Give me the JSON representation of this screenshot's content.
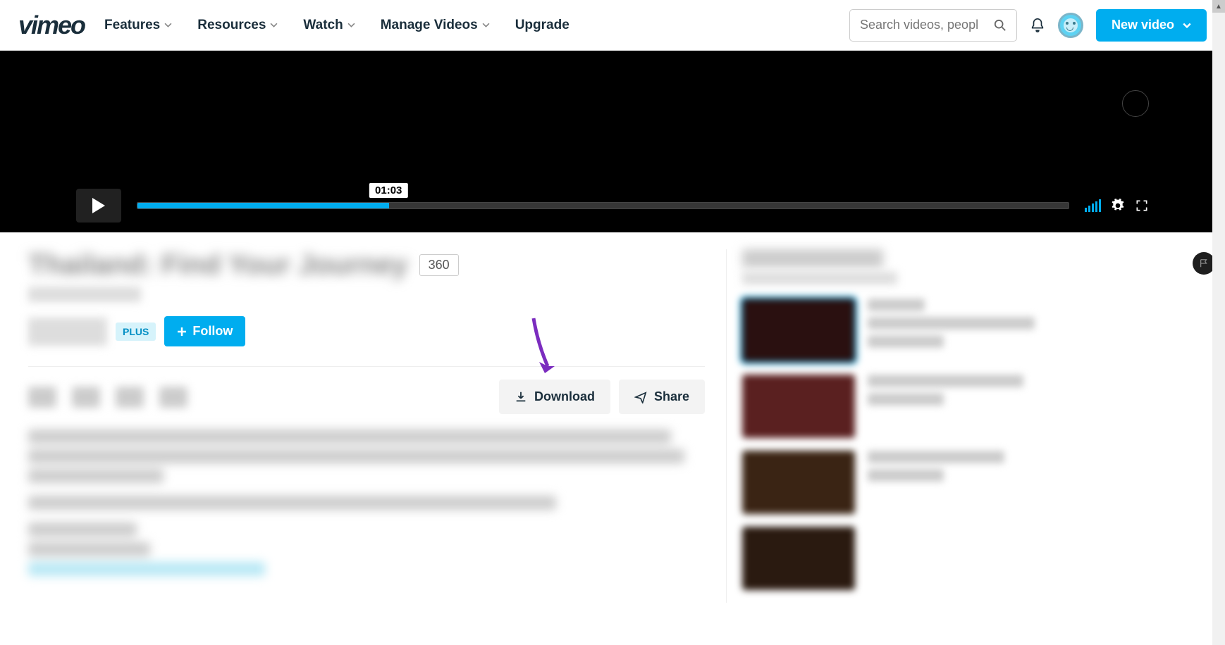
{
  "header": {
    "logo": "vimeo",
    "nav": {
      "features": "Features",
      "resources": "Resources",
      "watch": "Watch",
      "manage": "Manage Videos",
      "upgrade": "Upgrade"
    },
    "search_placeholder": "Search videos, peopl",
    "new_video": "New video"
  },
  "player": {
    "time_tooltip": "01:03"
  },
  "video": {
    "title": "Thailand: Find Your Journey",
    "badge_360": "360",
    "plus_label": "PLUS",
    "follow_label": "Follow"
  },
  "actions": {
    "download": "Download",
    "share": "Share"
  },
  "sidebar": {
    "title": "More from",
    "items": [
      {
        "thumb_color": "#2a1010"
      },
      {
        "thumb_color": "#5a2020"
      },
      {
        "thumb_color": "#3a2414"
      },
      {
        "thumb_color": "#2a1a10"
      }
    ]
  }
}
